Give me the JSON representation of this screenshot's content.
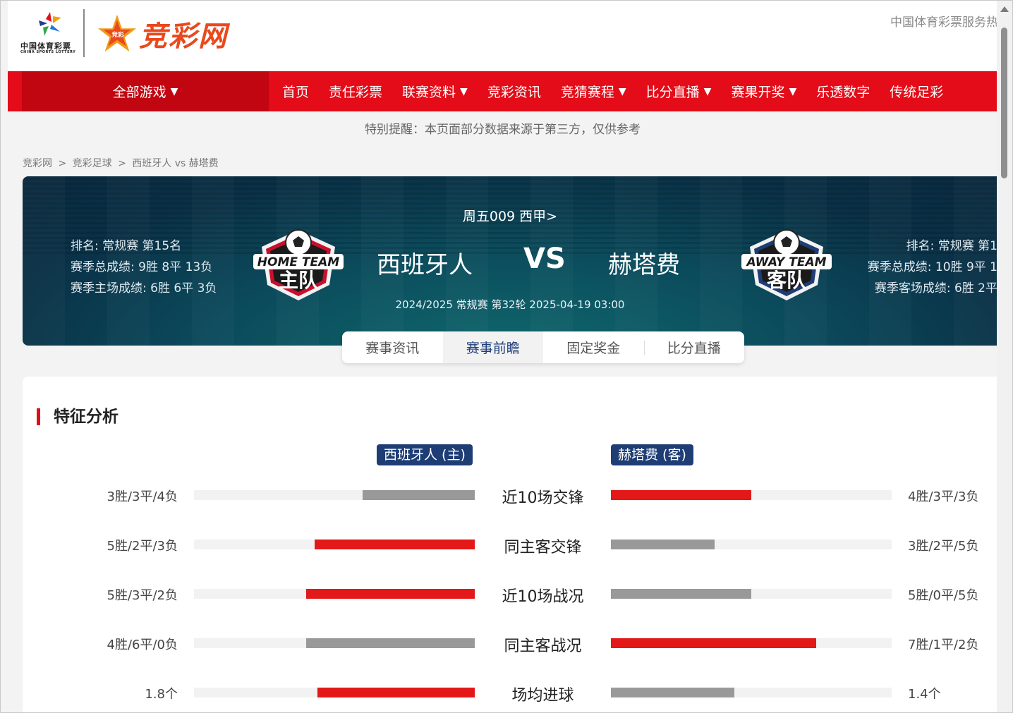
{
  "header": {
    "lottery_logo_cn": "中国体育彩票",
    "lottery_logo_en": "CHINA SPORTS LOTTERY",
    "site_logo_text": "竞彩网",
    "right_text": "中国体育彩票服务热线"
  },
  "nav": {
    "all_games": "全部游戏",
    "items": [
      {
        "label": "首页"
      },
      {
        "label": "责任彩票"
      },
      {
        "label": "联赛资料"
      },
      {
        "label": "竞彩资讯"
      },
      {
        "label": "竞猜赛程"
      },
      {
        "label": "比分直播"
      },
      {
        "label": "赛果开奖"
      },
      {
        "label": "乐透数字"
      },
      {
        "label": "传统足彩"
      }
    ]
  },
  "notice": "特别提醒：本页面部分数据来源于第三方，仅供参考",
  "breadcrumb": [
    "竞彩网",
    ">",
    "竞彩足球",
    ">",
    "西班牙人 vs 赫塔费"
  ],
  "match": {
    "round": "周五009 西甲>",
    "home_team": "西班牙人",
    "vs": "VS",
    "away_team": "赫塔费",
    "meta": "2024/2025 常规赛 第32轮 2025-04-19 03:00",
    "home_badge_top": "HOME TEAM",
    "home_badge_main": "主队",
    "away_badge_top": "AWAY TEAM",
    "away_badge_main": "客队",
    "home_stats": [
      "排名: 常规赛 第15名",
      "赛季总成绩: 9胜 8平 13负",
      "赛季主场成绩: 6胜 6平 3负"
    ],
    "away_stats": [
      "排名: 常规赛 第1",
      "赛季总成绩: 10胜 9平 1",
      "赛季客场成绩: 6胜 2平"
    ]
  },
  "tabs": [
    {
      "label": "赛事资讯"
    },
    {
      "label": "赛事前瞻"
    },
    {
      "label": "固定奖金"
    },
    {
      "label": "比分直播"
    }
  ],
  "analysis": {
    "title": "特征分析",
    "home_tag": "西班牙人 (主)",
    "away_tag": "赫塔费 (客)",
    "rows": [
      {
        "label": "近10场交锋",
        "home": "3胜/3平/4负",
        "away": "4胜/3平/3负",
        "home_pct": 0.4,
        "away_pct": 0.5,
        "home_color": "gray",
        "away_color": "red"
      },
      {
        "label": "同主客交锋",
        "home": "5胜/2平/3负",
        "away": "3胜/2平/5负",
        "home_pct": 0.57,
        "away_pct": 0.37,
        "home_color": "red",
        "away_color": "gray"
      },
      {
        "label": "近10场战况",
        "home": "5胜/3平/2负",
        "away": "5胜/0平/5负",
        "home_pct": 0.6,
        "away_pct": 0.5,
        "home_color": "red",
        "away_color": "gray"
      },
      {
        "label": "同主客战况",
        "home": "4胜/6平/0负",
        "away": "7胜/1平/2负",
        "home_pct": 0.6,
        "away_pct": 0.73,
        "home_color": "gray",
        "away_color": "red"
      },
      {
        "label": "场均进球",
        "home": "1.8个",
        "away": "1.4个",
        "home_pct": 0.56,
        "away_pct": 0.44,
        "home_color": "red",
        "away_color": "gray"
      }
    ]
  },
  "colors": {
    "nav_red": "#e30c18",
    "nav_dark_red": "#c10612",
    "team_tag_blue": "#1e3d75",
    "bar_red": "#e31818",
    "bar_gray": "#999999"
  }
}
